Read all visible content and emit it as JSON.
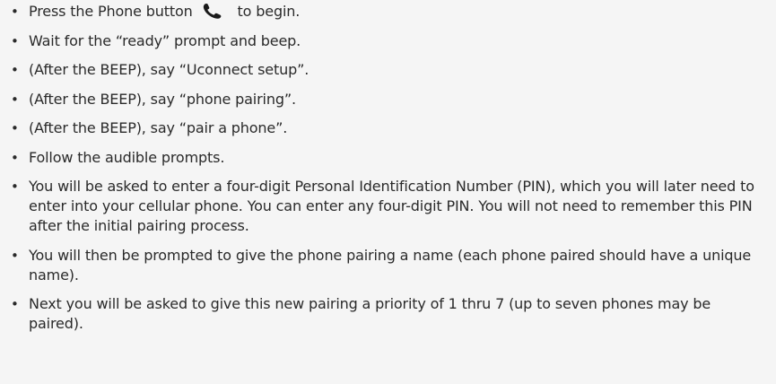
{
  "steps": [
    {
      "before_icon": "Press the Phone button",
      "icon": "phone-handset-icon",
      "after_icon": "to begin."
    },
    {
      "text": "Wait for the “ready” prompt and beep."
    },
    {
      "text": "(After the BEEP), say “Uconnect setup”."
    },
    {
      "text": "(After the BEEP), say “phone pairing”."
    },
    {
      "text": "(After the BEEP), say “pair a phone”."
    },
    {
      "text": "Follow the audible prompts."
    },
    {
      "text": "You will be asked to enter a four-digit Personal Identification Number (PIN), which you will later need to enter into your cellular phone. You can enter any four-digit PIN. You will not need to remember this PIN after the initial pairing process."
    },
    {
      "text": "You will then be prompted to give the phone pairing a name (each phone paired should have a unique name)."
    },
    {
      "text": "Next you will be asked to give this new pairing a priority of 1 thru 7 (up to seven phones may be paired)."
    }
  ],
  "colors": {
    "background": "#f5f5f5",
    "text": "#2a2a2a"
  }
}
